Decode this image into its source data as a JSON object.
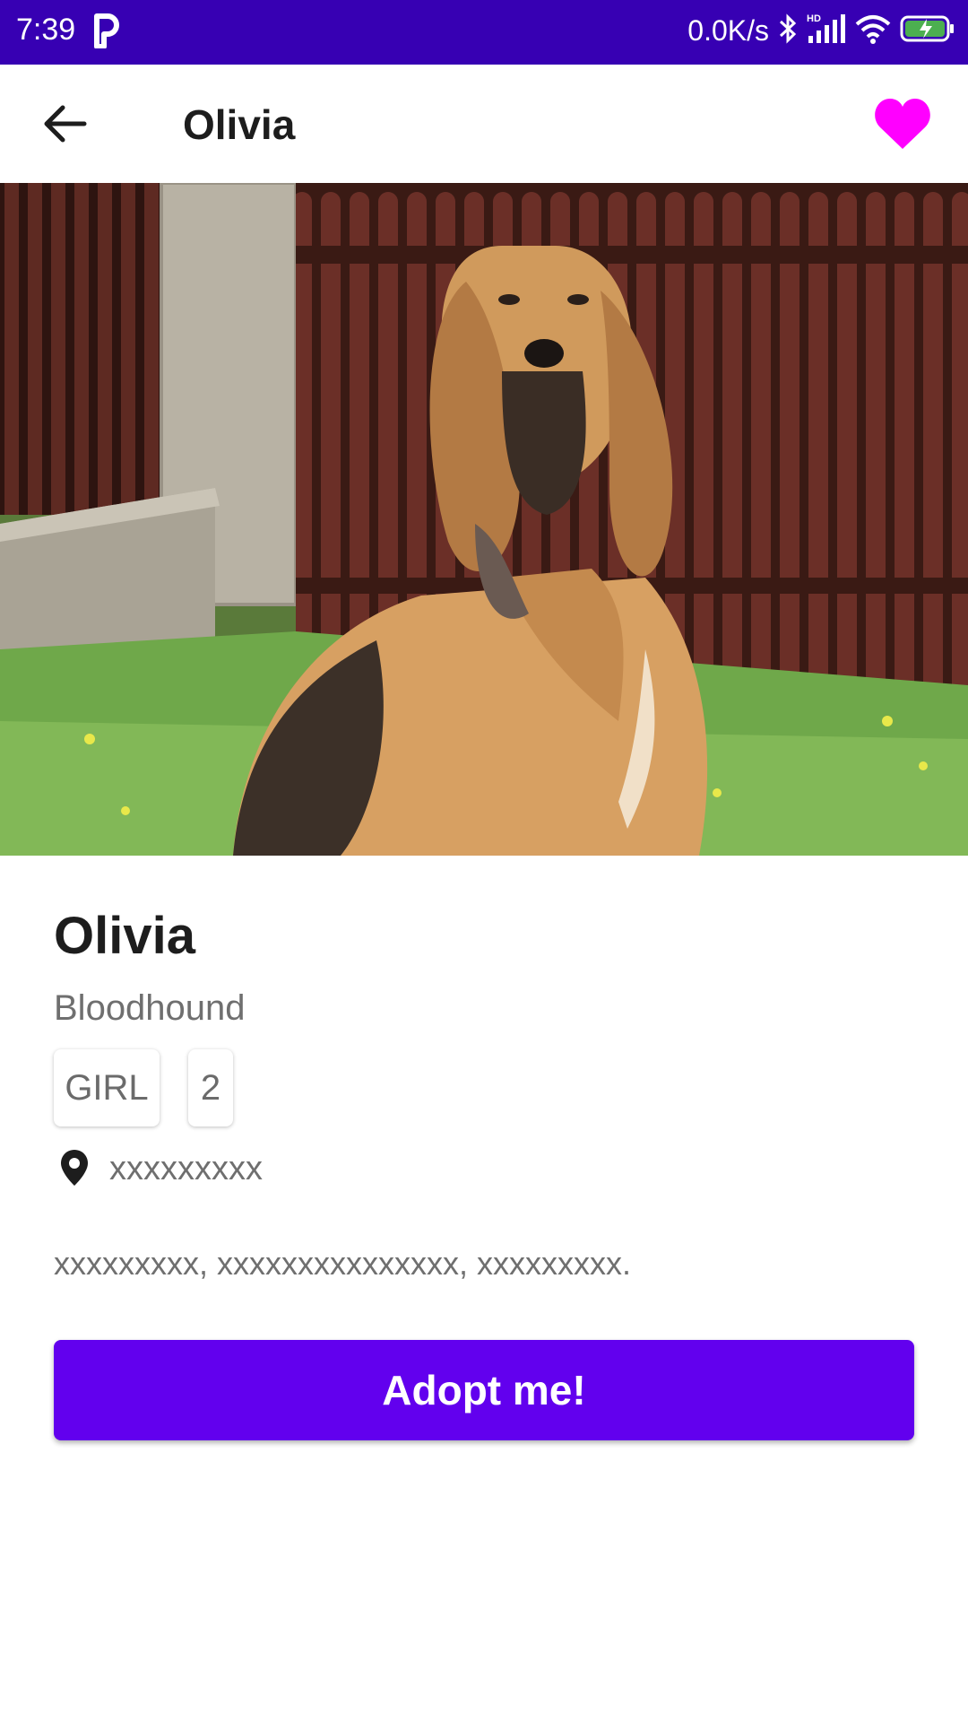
{
  "status_bar": {
    "time": "7:39",
    "app_indicator": "P",
    "net_speed": "0.0K/s",
    "icons": [
      "bluetooth-icon",
      "hd-signal-icon",
      "wifi-icon",
      "battery-charging-icon"
    ]
  },
  "app_bar": {
    "title": "Olivia",
    "back_icon": "arrow-back-icon",
    "favorite_icon": "heart-icon",
    "favorite_color": "#ff00ff"
  },
  "hero": {
    "image": "dog-photo-bloodhound"
  },
  "pet": {
    "name": "Olivia",
    "breed": "Bloodhound",
    "gender": "GIRL",
    "age": "2",
    "location": "xxxxxxxxx",
    "description": "xxxxxxxxx, xxxxxxxxxxxxxxx, xxxxxxxxx."
  },
  "actions": {
    "adopt_label": "Adopt me!"
  },
  "colors": {
    "status_bar": "#3700b3",
    "primary": "#6200ee",
    "favorite": "#ff00ff"
  }
}
